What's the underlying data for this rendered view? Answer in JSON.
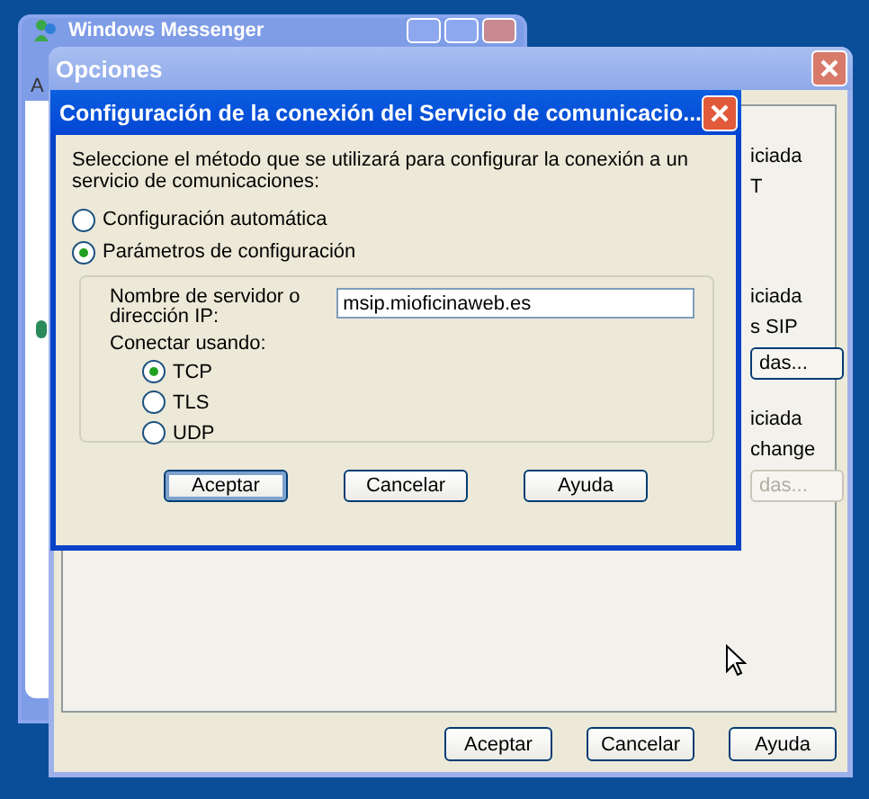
{
  "back_window": {
    "title": "Windows Messenger",
    "menu_letter": "A"
  },
  "options_window": {
    "title": "Opciones",
    "panel_fragments": [
      {
        "kind": "text",
        "text": "iciada"
      },
      {
        "kind": "text",
        "text": "T"
      },
      {
        "kind": "gap"
      },
      {
        "kind": "text",
        "text": "iciada"
      },
      {
        "kind": "text",
        "text": "s SIP"
      },
      {
        "kind": "button",
        "text": "das...",
        "disabled": false
      },
      {
        "kind": "text",
        "text": "iciada"
      },
      {
        "kind": "text",
        "text": "change"
      },
      {
        "kind": "button",
        "text": "das...",
        "disabled": true
      }
    ],
    "buttons": [
      "Aceptar",
      "Cancelar",
      "Ayuda"
    ]
  },
  "dialog": {
    "title": "Configuración de la conexión del Servicio de comunicacio...",
    "intro": "Seleccione el método que se utilizará para configurar la conexión a un servicio de comunicaciones:",
    "methods": [
      {
        "label": "Configuración automática",
        "selected": false
      },
      {
        "label": "Parámetros de configuración",
        "selected": true
      }
    ],
    "server_label": "Nombre de servidor o dirección IP:",
    "server_value": "msip.mioficinaweb.es",
    "connect_label": "Conectar usando:",
    "protocols": [
      {
        "label": "TCP",
        "selected": true
      },
      {
        "label": "TLS",
        "selected": false
      },
      {
        "label": "UDP",
        "selected": false
      }
    ],
    "buttons": [
      "Aceptar",
      "Cancelar",
      "Ayuda"
    ]
  }
}
